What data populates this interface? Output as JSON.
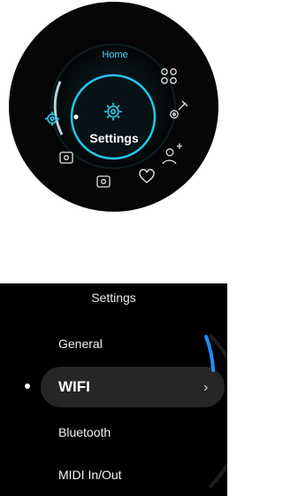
{
  "home": {
    "tab_label": "Home",
    "center_label": "Settings",
    "accent_color": "#1ec8e6",
    "icons": [
      "settings-icon",
      "apps-grid-icon",
      "guitar-icon",
      "user-add-icon",
      "heart-icon",
      "fader-icon",
      "device-icon"
    ]
  },
  "settings_list": {
    "title": "Settings",
    "items": [
      {
        "label": "General"
      },
      {
        "label": "WIFI",
        "selected": true
      },
      {
        "label": "Bluetooth"
      },
      {
        "label": "MIDI In/Out"
      }
    ],
    "scroll_color": "#1f8cff"
  }
}
